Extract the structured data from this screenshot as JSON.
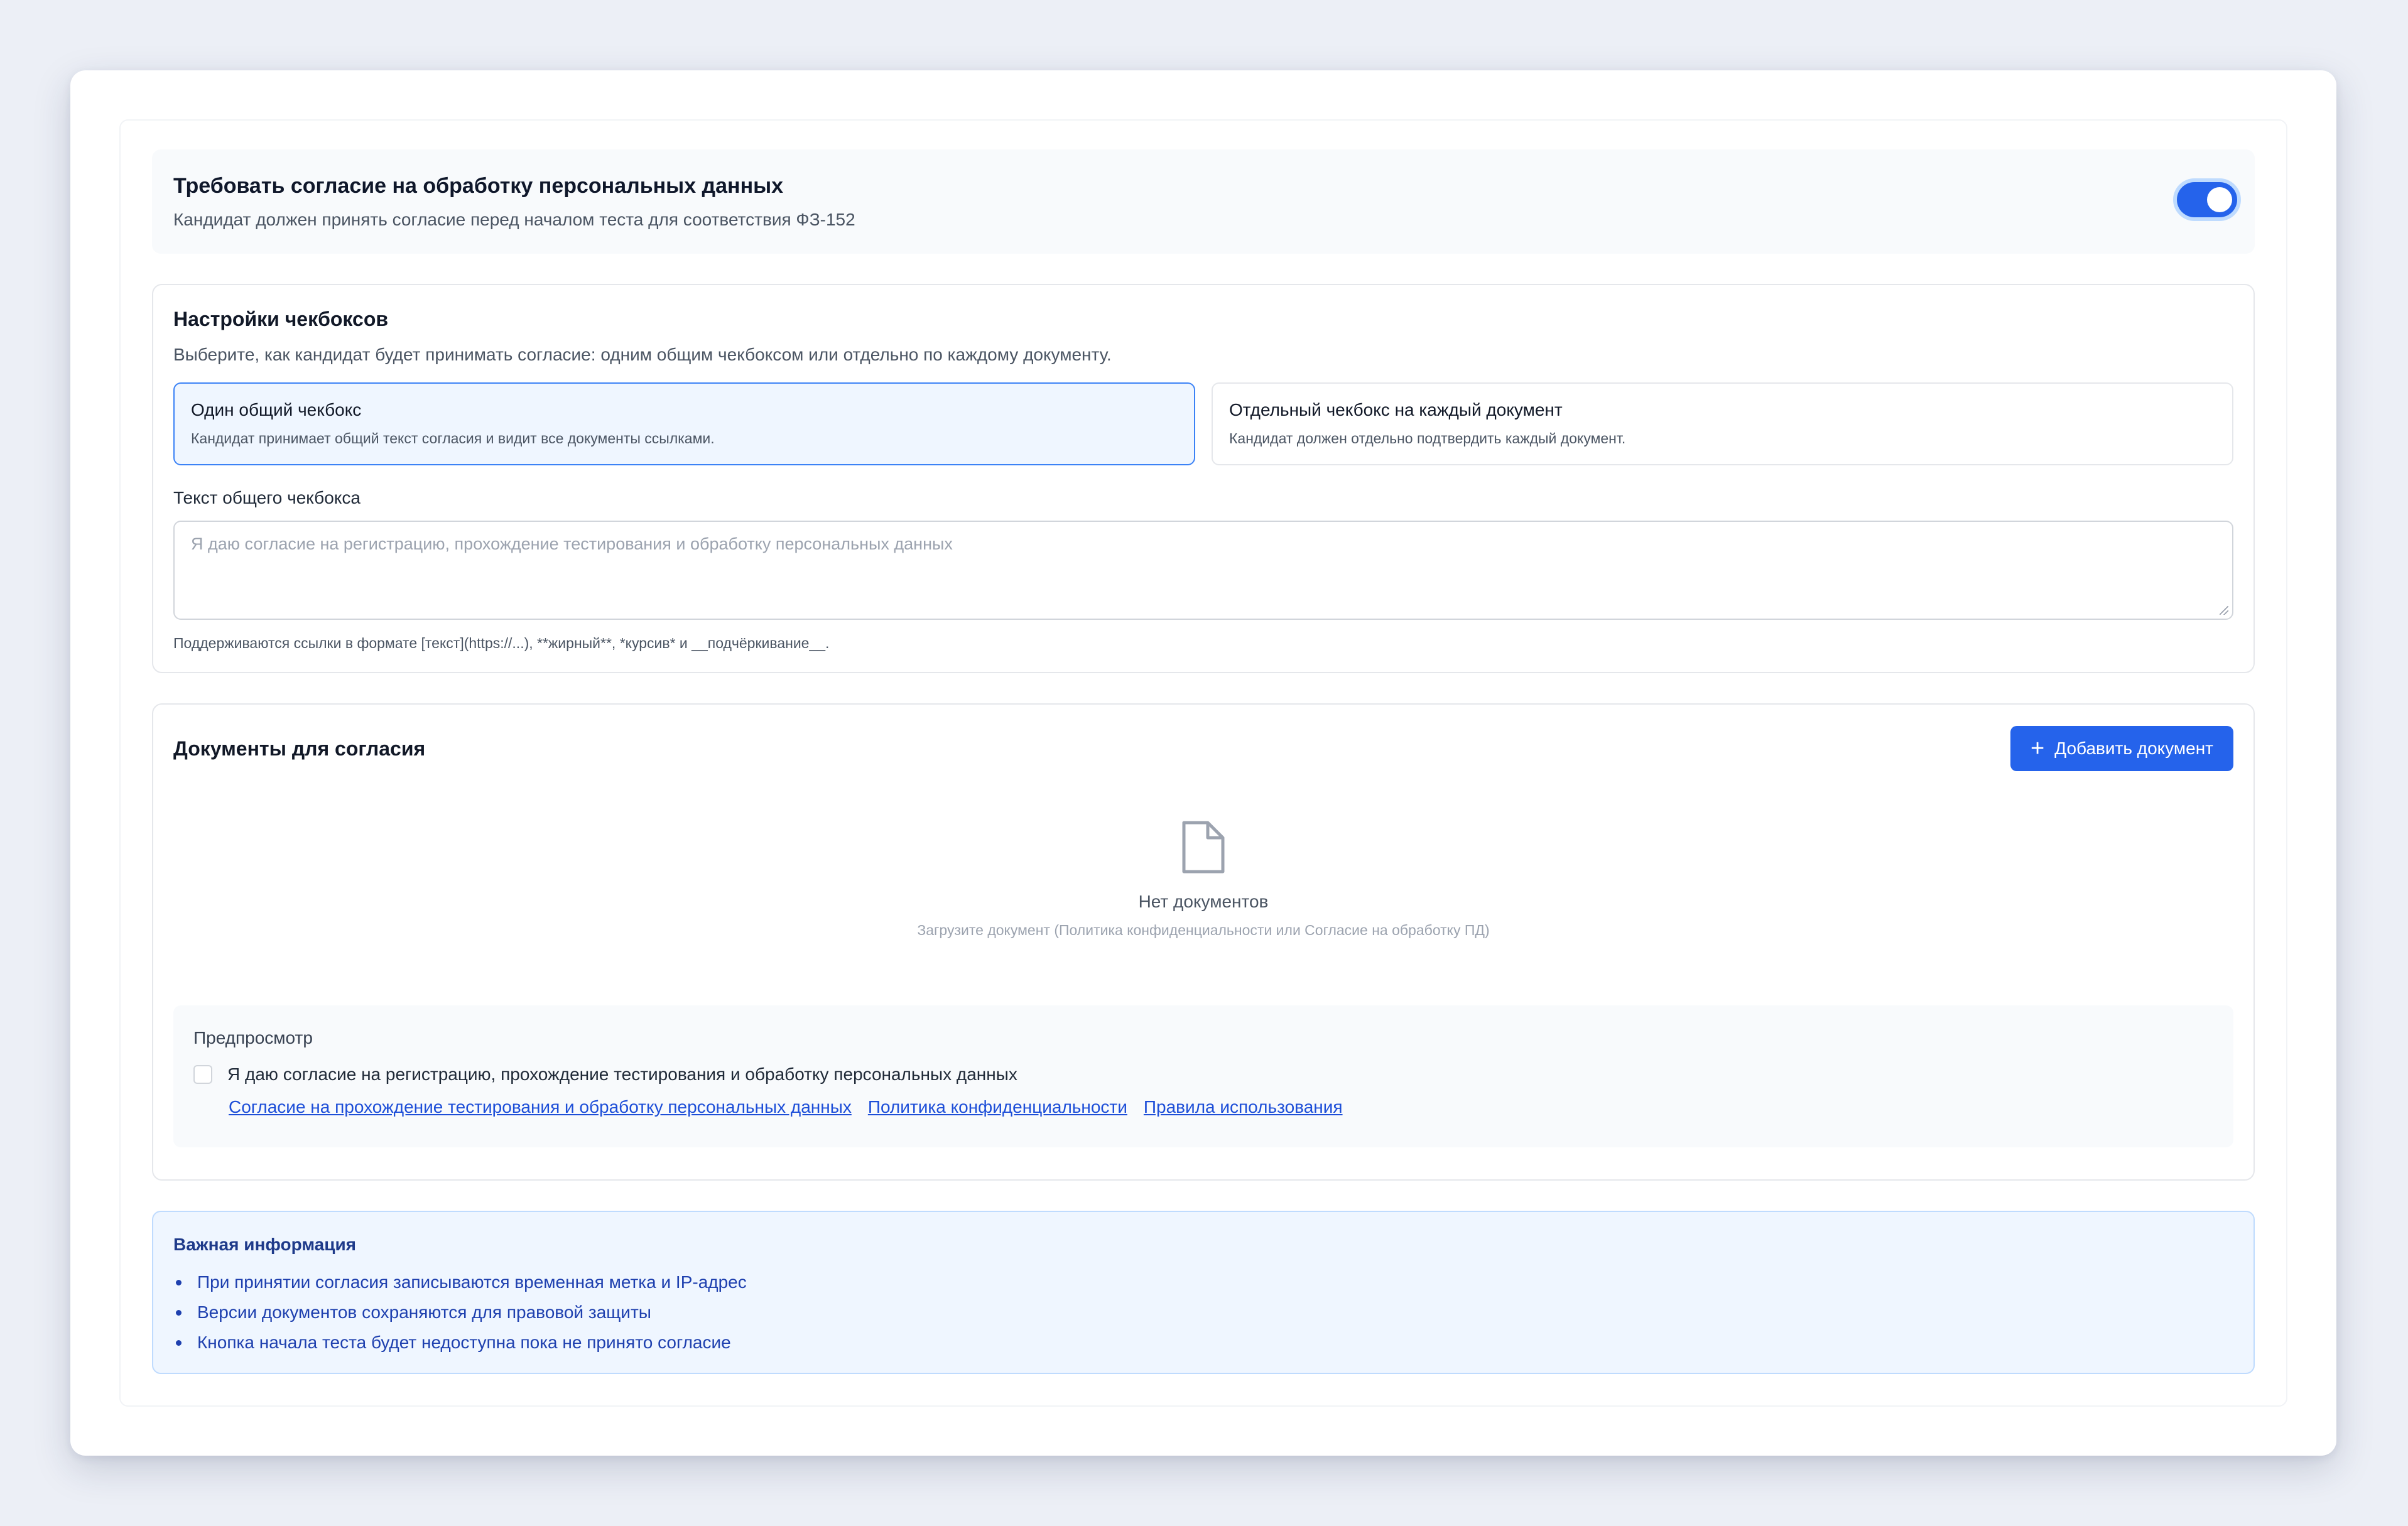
{
  "consent": {
    "title": "Требовать согласие на обработку персональных данных",
    "subtitle": "Кандидат должен принять согласие перед началом теста для соответствия ФЗ-152",
    "enabled": true
  },
  "checkbox_settings": {
    "title": "Настройки чекбоксов",
    "description": "Выберите, как кандидат будет принимать согласие: одним общим чекбоксом или отдельно по каждому документу.",
    "options": [
      {
        "title": "Один общий чекбокс",
        "subtitle": "Кандидат принимает общий текст согласия и видит все документы ссылками.",
        "selected": true
      },
      {
        "title": "Отдельный чекбокс на каждый документ",
        "subtitle": "Кандидат должен отдельно подтвердить каждый документ.",
        "selected": false
      }
    ],
    "text_label": "Текст общего чекбокса",
    "text_placeholder": "Я даю согласие на регистрацию, прохождение тестирования и обработку персональных данных",
    "hint": "Поддерживаются ссылки в формате [текст](https://...), **жирный**, *курсив* и __подчёркивание__."
  },
  "documents": {
    "title": "Документы для согласия",
    "add_button": "Добавить документ",
    "empty_title": "Нет документов",
    "empty_subtitle": "Загрузите документ (Политика конфиденциальности или Согласие на обработку ПД)",
    "preview": {
      "label": "Предпросмотр",
      "checkbox_text": "Я даю согласие на регистрацию, прохождение тестирования и обработку персональных данных",
      "links": [
        "Согласие на прохождение тестирования и обработку персональных данных",
        "Политика конфиденциальности",
        "Правила использования"
      ]
    }
  },
  "info": {
    "title": "Важная информация",
    "items": [
      "При принятии согласия записываются временная метка и IP-адрес",
      "Версии документов сохраняются для правовой защиты",
      "Кнопка начала теста будет недоступна пока не принято согласие"
    ]
  },
  "icons": {
    "toggle": "toggle-switch-icon",
    "add": "plus-icon",
    "empty": "file-icon"
  },
  "colors": {
    "accent": "#2563eb",
    "info_bg": "#eff6ff",
    "info_text": "#1e40af"
  }
}
